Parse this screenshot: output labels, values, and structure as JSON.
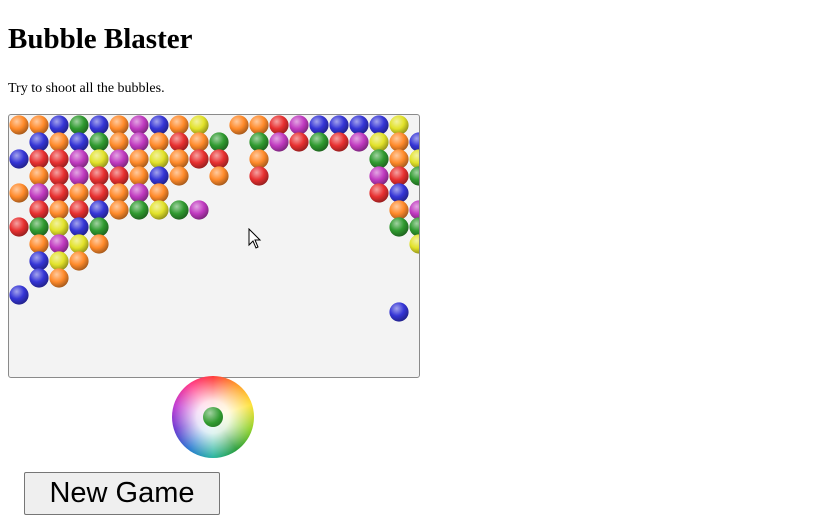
{
  "page": {
    "title": "Bubble Blaster",
    "instructions": "Try to shoot all the bubbles."
  },
  "palette": {
    "O": "#ff8a2a",
    "B": "#3535d6",
    "G": "#2f9a2f",
    "R": "#e83030",
    "P": "#c03ac0",
    "Y": "#e2e22a"
  },
  "board": {
    "background": "#f3f3f3",
    "rows": [
      "OOBGBOPBOY.OORPBBBBY",
      ".BOBGOPOROG.GPRGRPYOBY",
      "BRRPYPOYORR.O.....GOYRO",
      ".ORPRROBO.O.R.....PRGGO",
      "OPROROPO..........RB",
      ".RORBOGYGP.........OPP",
      "RGYBG..............GGR",
      ".OPYO...............YRB",
      ".BYO.................B",
      ".BO..................YY",
      "B....................R",
      "...................B"
    ]
  },
  "shooter": {
    "current_bubble": "G",
    "aim_icon": "color-wheel-icon"
  },
  "controls": {
    "new_game_label": "New Game"
  }
}
